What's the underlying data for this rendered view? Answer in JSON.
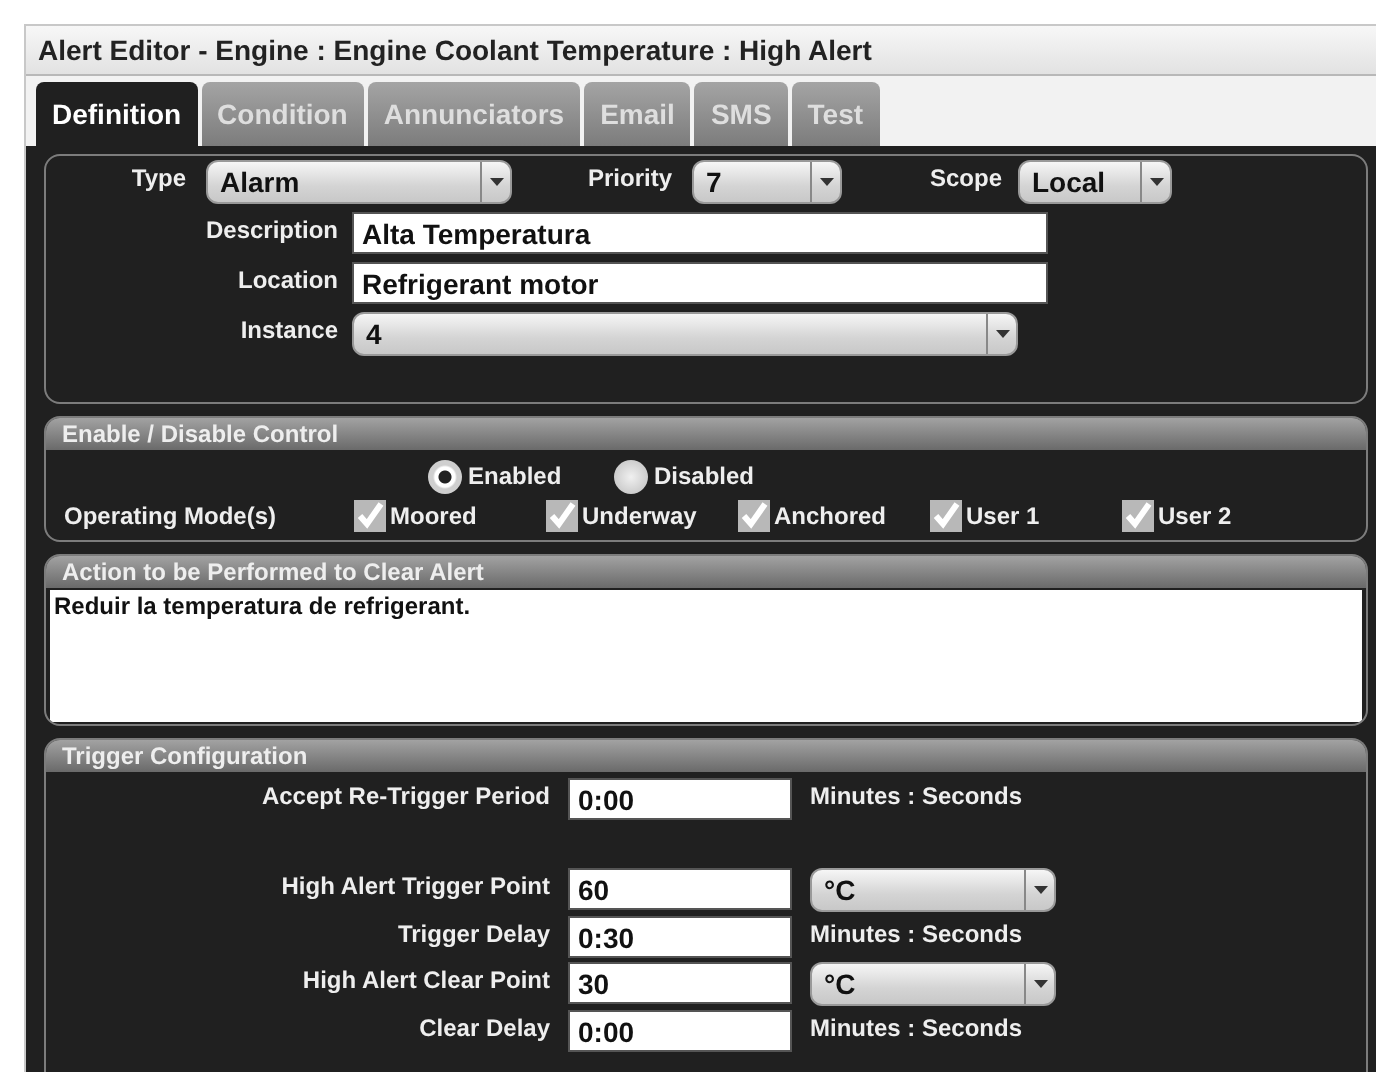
{
  "window": {
    "title": "Alert Editor - Engine : Engine Coolant Temperature : High Alert"
  },
  "tabs": [
    {
      "label": "Definition",
      "selected": true
    },
    {
      "label": "Condition",
      "selected": false
    },
    {
      "label": "Annunciators",
      "selected": false
    },
    {
      "label": "Email",
      "selected": false
    },
    {
      "label": "SMS",
      "selected": false
    },
    {
      "label": "Test",
      "selected": false
    }
  ],
  "definition": {
    "type": {
      "label": "Type",
      "value": "Alarm"
    },
    "priority": {
      "label": "Priority",
      "value": "7"
    },
    "scope": {
      "label": "Scope",
      "value": "Local"
    },
    "description": {
      "label": "Description",
      "value": "Alta Temperatura"
    },
    "location": {
      "label": "Location",
      "value": "Refrigerant motor"
    },
    "instance": {
      "label": "Instance",
      "value": "4"
    }
  },
  "enable_control": {
    "title": "Enable / Disable Control",
    "states": [
      {
        "label": "Enabled",
        "selected": true
      },
      {
        "label": "Disabled",
        "selected": false
      }
    ],
    "modes_label": "Operating Mode(s)",
    "modes": [
      {
        "label": "Moored",
        "checked": true
      },
      {
        "label": "Underway",
        "checked": true
      },
      {
        "label": "Anchored",
        "checked": true
      },
      {
        "label": "User 1",
        "checked": true
      },
      {
        "label": "User 2",
        "checked": true
      }
    ]
  },
  "clear_action": {
    "title": "Action to be Performed to Clear Alert",
    "text": "Reduir la temperatura de refrigerant."
  },
  "trigger": {
    "title": "Trigger Configuration",
    "retrigger": {
      "kind": "time",
      "label": "Accept Re-Trigger Period",
      "value": "0:00",
      "units": "Minutes : Seconds"
    },
    "rows": [
      {
        "kind": "point",
        "label": "High Alert Trigger Point",
        "value": "60",
        "units": "°C"
      },
      {
        "kind": "time",
        "label": "Trigger Delay",
        "value": "0:30",
        "units": "Minutes : Seconds"
      },
      {
        "kind": "point",
        "label": "High Alert Clear Point",
        "value": "30",
        "units": "°C"
      },
      {
        "kind": "time",
        "label": "Clear Delay",
        "value": "0:00",
        "units": "Minutes : Seconds"
      }
    ]
  }
}
